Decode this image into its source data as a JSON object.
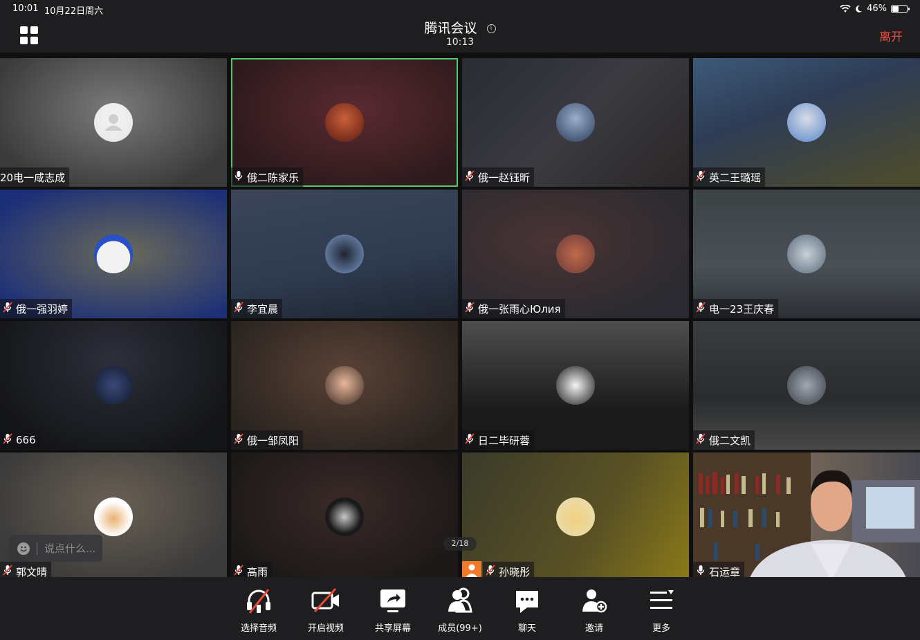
{
  "status_bar": {
    "time": "10:01",
    "date": "10月22日周六",
    "battery": "46%",
    "battery_level": 0.46
  },
  "header": {
    "title": "腾讯会议",
    "duration": "10:13",
    "leave_label": "离开"
  },
  "participants": [
    {
      "name": "20电一咸志成",
      "mic": "none",
      "active": false
    },
    {
      "name": "俄二陈家乐",
      "mic": "on",
      "active": true
    },
    {
      "name": "俄一赵钰昕",
      "mic": "muted",
      "active": false
    },
    {
      "name": "英二王璐瑶",
      "mic": "muted",
      "active": false
    },
    {
      "name": "俄一强羽婷",
      "mic": "muted",
      "active": false
    },
    {
      "name": "李宜晨",
      "mic": "muted",
      "active": false
    },
    {
      "name": "俄一张雨心Юлия",
      "mic": "muted",
      "active": false
    },
    {
      "name": "电一23王庆春",
      "mic": "muted",
      "active": false
    },
    {
      "name": "666",
      "mic": "muted",
      "active": false
    },
    {
      "name": "俄一邹凤阳",
      "mic": "muted",
      "active": false
    },
    {
      "name": "日二毕研蓉",
      "mic": "muted",
      "active": false
    },
    {
      "name": "俄二文凯",
      "mic": "muted",
      "active": false
    },
    {
      "name": "郭文晴",
      "mic": "muted",
      "active": false
    },
    {
      "name": "高雨",
      "mic": "muted",
      "active": false
    },
    {
      "name": "孙晓彤",
      "mic": "muted",
      "active": false
    },
    {
      "name": "石运章",
      "mic": "on",
      "active": false
    }
  ],
  "chat_input": {
    "placeholder": "说点什么..."
  },
  "pager": "2/18",
  "toolbar": {
    "audio": "选择音频",
    "video": "开启视频",
    "share": "共享屏幕",
    "members": "成员(99+)",
    "chat": "聊天",
    "invite": "邀请",
    "more": "更多"
  },
  "colors": {
    "leave": "#f04a3c",
    "active_border": "#4fca6a",
    "muted_mic": "#e84b3a"
  }
}
